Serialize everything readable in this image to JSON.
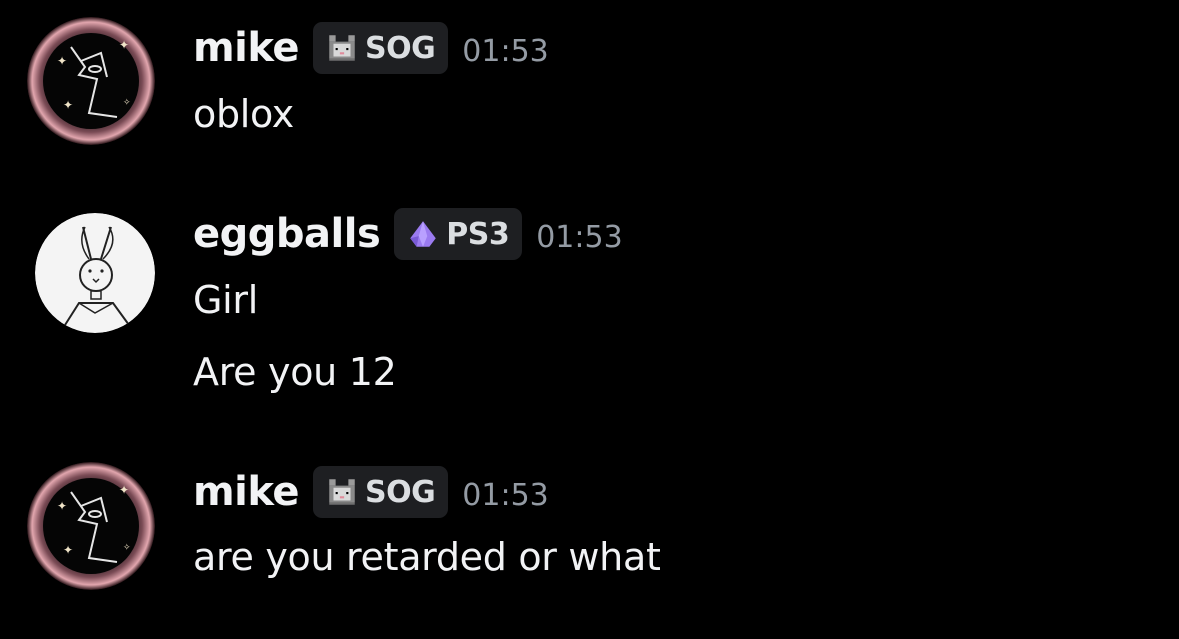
{
  "messages": [
    {
      "username": "mike",
      "tag_icon": "pixel-cat-icon",
      "tag": "SOG",
      "time": "01:53",
      "lines": [
        "oblox"
      ]
    },
    {
      "username": "eggballs",
      "tag_icon": "purple-gem-icon",
      "tag": "PS3",
      "time": "01:53",
      "lines": [
        "Girl",
        "Are you 12"
      ]
    },
    {
      "username": "mike",
      "tag_icon": "pixel-cat-icon",
      "tag": "SOG",
      "time": "01:53",
      "lines": [
        "are you retarded or what"
      ]
    }
  ],
  "colors": {
    "background": "#000000",
    "username": "#f2f3f5",
    "tag_bg": "#1e1f22",
    "timestamp": "#949ba4",
    "gem": "#9b7bf0"
  }
}
